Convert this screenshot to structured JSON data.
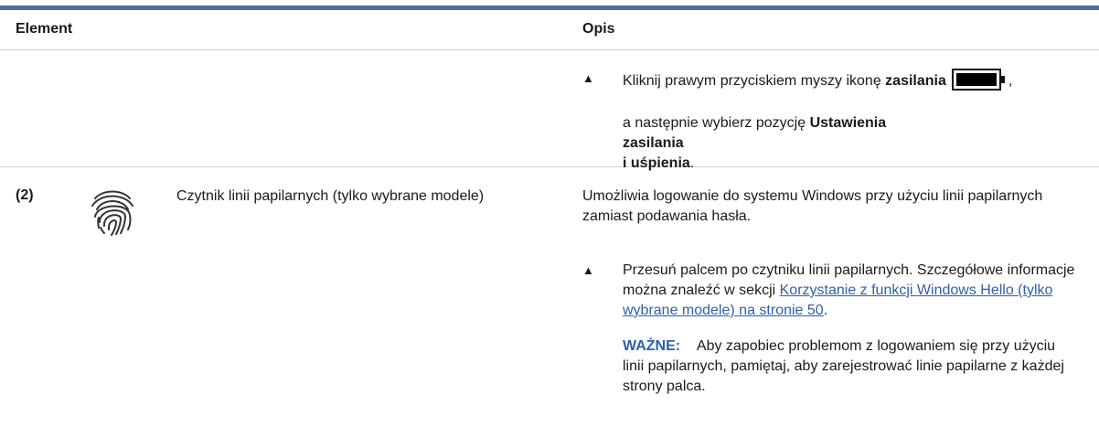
{
  "header": {
    "col_element": "Element",
    "col_opis": "Opis"
  },
  "row1": {
    "bullet": "▲",
    "text_pre": "Kliknij prawym przyciskiem myszy ikonę ",
    "text_bold": "zasilania",
    "comma": ",",
    "line2_pre": "a następnie wybierz pozycję ",
    "line2_bold": "Ustawienia zasilania",
    "line3_bold": "i uśpienia",
    "line3_post": "."
  },
  "row2": {
    "number": "(2)",
    "icon": "fingerprint-icon",
    "element_text": "Czytnik linii papilarnych (tylko wybrane modele)",
    "desc": "Umożliwia logowanie do systemu Windows przy użyciu linii papilarnych zamiast podawania hasła.",
    "bullet": "▲",
    "step_pre": "Przesuń palcem po czytniku linii papilarnych. Szczegółowe informacje można znaleźć w sekcji ",
    "step_link": "Korzystanie z funkcji Windows Hello (tylko wybrane modele) na stronie 50",
    "step_post": ".",
    "important_label": "WAŻNE:",
    "important_text": "Aby zapobiec problemom z logowaniem się przy użyciu linii papilarnych, pamiętaj, aby zarejestrować linie papilarne z każdej strony palca."
  },
  "colors": {
    "accent": "#4a6ea3",
    "link": "#2f5fa8"
  }
}
